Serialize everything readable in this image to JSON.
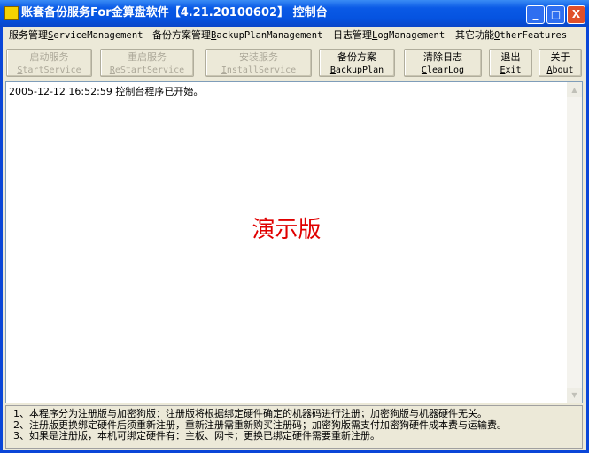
{
  "window": {
    "title": "账套备份服务For金算盘软件【4.21.20100602】 控制台",
    "controls": [
      "_",
      "□",
      "X"
    ]
  },
  "menu": [
    {
      "cn": "服务管理",
      "en": "ServiceManagement"
    },
    {
      "cn": "备份方案管理",
      "en": "BackupPlanManagement"
    },
    {
      "cn": "日志管理",
      "en": "LogManagement"
    },
    {
      "cn": "其它功能",
      "en": "OtherFeatures"
    }
  ],
  "toolbar": [
    {
      "cn": "启动服务",
      "en": "StartService",
      "enabled": false
    },
    {
      "cn": "重启服务",
      "en": "ReStartService",
      "enabled": false
    },
    {
      "cn": "安装服务",
      "en": "InstallService",
      "enabled": false
    },
    {
      "cn": "备份方案",
      "en": "BackupPlan",
      "enabled": true
    },
    {
      "cn": "清除日志",
      "en": "ClearLog",
      "enabled": true
    },
    {
      "cn": "退出",
      "en": "Exit",
      "enabled": true
    },
    {
      "cn": "关于",
      "en": "About",
      "enabled": true
    }
  ],
  "log": {
    "lines": [
      "2005-12-12 16:52:59 控制台程序已开始。"
    ],
    "watermark": "演示版"
  },
  "notes": [
    "1、本程序分为注册版与加密狗版：注册版将根据绑定硬件确定的机器码进行注册；加密狗版与机器硬件无关。",
    "2、注册版更换绑定硬件后须重新注册，重新注册需重新购买注册码；加密狗版需支付加密狗硬件成本费与运输费。",
    "3、如果是注册版，本机可绑定硬件有：主板、网卡；更换已绑定硬件需要重新注册。"
  ]
}
